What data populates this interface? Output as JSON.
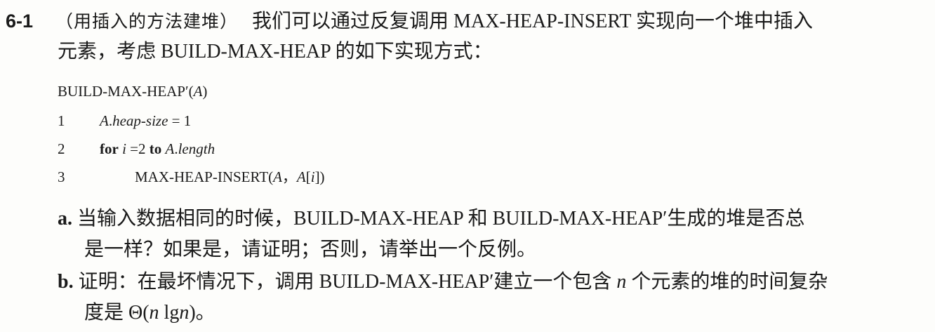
{
  "problem": {
    "number": "6-1",
    "subtitle": "（用插入的方法建堆）",
    "line1_text": "我们可以通过反复调用 MAX-HEAP-INSERT 实现向一个堆中插入",
    "line2_text": "元素，考虑 BUILD-MAX-HEAP 的如下实现方式："
  },
  "code": {
    "header_name": "BUILD-MAX-HEAP′(",
    "header_arg": "A",
    "header_close": ")",
    "lines": [
      {
        "num": "1",
        "a_var": "A",
        "a_dot": ".",
        "a_field": "heap-size",
        "a_rest": " = 1"
      },
      {
        "num": "2",
        "kw_for": "for",
        "var_i": "i",
        "eq": " =2 ",
        "kw_to": "to",
        "var_a": "A",
        "dot": ".",
        "field": "length"
      },
      {
        "num": "3",
        "call": "MAX-HEAP-INSERT(",
        "arg_a": "A",
        "sep": "，",
        "arg_a2": "A",
        "br_open": "[",
        "arg_i": "i",
        "br_close": "])"
      }
    ]
  },
  "parts": [
    {
      "label": "a.",
      "line1": "当输入数据相同的时候，BUILD-MAX-HEAP 和 BUILD-MAX-HEAP′生成的堆是否总",
      "line2": "是一样？如果是，请证明；否则，请举出一个反例。"
    },
    {
      "label": "b.",
      "line1_a": "证明：在最坏情况下，调用 BUILD-MAX-HEAP′建立一个包含 ",
      "line1_n": "n",
      "line1_b": " 个元素的堆的时间复杂",
      "line2_a": "度是 Θ(",
      "line2_n1": "n",
      "line2_mid": " lg",
      "line2_n2": "n",
      "line2_b": ")。"
    }
  ]
}
